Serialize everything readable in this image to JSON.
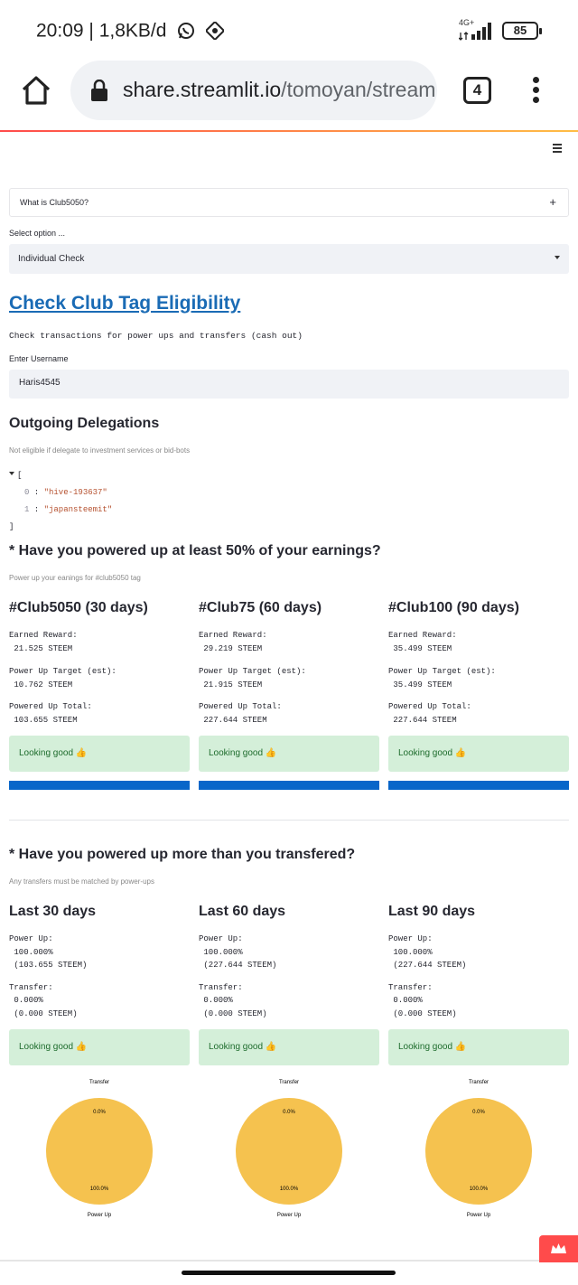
{
  "status_bar": {
    "time": "20:09",
    "data_rate": "1,8KB/d",
    "network": "4G+",
    "battery": "85"
  },
  "browser": {
    "url_host": "share.streamlit.io",
    "url_path": "/tomoyan/stream",
    "tab_count": "4"
  },
  "app": {
    "expander_label": "What is Club5050?",
    "expander_icon": "+",
    "select_label": "Select option ...",
    "select_value": "Individual Check",
    "title": "Check Club Tag Eligibility",
    "description": "Check transactions for power ups and transfers (cash out)",
    "username_label": "Enter Username",
    "username_value": "Haris4545",
    "delegations": {
      "heading": "Outgoing Delegations",
      "caption": "Not eligible if delegate to investment services or bid-bots",
      "json_open": "[",
      "json_close": "]",
      "items": [
        {
          "index": "0",
          "value": "\"hive-193637\""
        },
        {
          "index": "1",
          "value": "\"japansteemit\""
        }
      ]
    },
    "powerup_section": {
      "heading": "* Have you powered up at least 50% of your earnings?",
      "caption": "Power up your eanings for #club5050 tag",
      "columns": [
        {
          "title": "#Club5050 (30 days)",
          "earned_label": "Earned Reward:",
          "earned_value": " 21.525 STEEM",
          "target_label": "Power Up Target (est):",
          "target_value": " 10.762 STEEM",
          "total_label": "Powered Up Total:",
          "total_value": " 103.655 STEEM",
          "status": "Looking good 👍",
          "progress": 1.0
        },
        {
          "title": "#Club75 (60 days)",
          "earned_label": "Earned Reward:",
          "earned_value": " 29.219 STEEM",
          "target_label": "Power Up Target (est):",
          "target_value": " 21.915 STEEM",
          "total_label": "Powered Up Total:",
          "total_value": " 227.644 STEEM",
          "status": "Looking good 👍",
          "progress": 1.0
        },
        {
          "title": "#Club100 (90 days)",
          "earned_label": "Earned Reward:",
          "earned_value": " 35.499 STEEM",
          "target_label": "Power Up Target (est):",
          "target_value": " 35.499 STEEM",
          "total_label": "Powered Up Total:",
          "total_value": " 227.644 STEEM",
          "status": "Looking good 👍",
          "progress": 1.0
        }
      ]
    },
    "transfer_section": {
      "heading": "* Have you powered up more than you transfered?",
      "caption": "Any transfers must be matched by power-ups",
      "columns": [
        {
          "title": "Last 30 days",
          "powerup_label": "Power Up:",
          "powerup_pct": " 100.000%",
          "powerup_amt": " (103.655 STEEM)",
          "transfer_label": "Transfer:",
          "transfer_pct": " 0.000%",
          "transfer_amt": " (0.000 STEEM)",
          "status": "Looking good 👍"
        },
        {
          "title": "Last 60 days",
          "powerup_label": "Power Up:",
          "powerup_pct": " 100.000%",
          "powerup_amt": " (227.644 STEEM)",
          "transfer_label": "Transfer:",
          "transfer_pct": " 0.000%",
          "transfer_amt": " (0.000 STEEM)",
          "status": "Looking good 👍"
        },
        {
          "title": "Last 90 days",
          "powerup_label": "Power Up:",
          "powerup_pct": " 100.000%",
          "powerup_amt": " (227.644 STEEM)",
          "transfer_label": "Transfer:",
          "transfer_pct": " 0.000%",
          "transfer_amt": " (0.000 STEEM)",
          "status": "Looking good 👍"
        }
      ]
    },
    "colors": {
      "link": "#1a6bb5",
      "progress": "#0866c9",
      "success_bg": "#d4efd9",
      "pie_powerup": "#f5c24f"
    }
  },
  "chart_data": [
    {
      "type": "pie",
      "categories": [
        "Transfer",
        "Power Up"
      ],
      "values": [
        0.0,
        100.0
      ],
      "labels": [
        "0.0%",
        "100.0%"
      ]
    },
    {
      "type": "pie",
      "categories": [
        "Transfer",
        "Power Up"
      ],
      "values": [
        0.0,
        100.0
      ],
      "labels": [
        "0.0%",
        "100.0%"
      ]
    },
    {
      "type": "pie",
      "categories": [
        "Transfer",
        "Power Up"
      ],
      "values": [
        0.0,
        100.0
      ],
      "labels": [
        "0.0%",
        "100.0%"
      ]
    }
  ]
}
